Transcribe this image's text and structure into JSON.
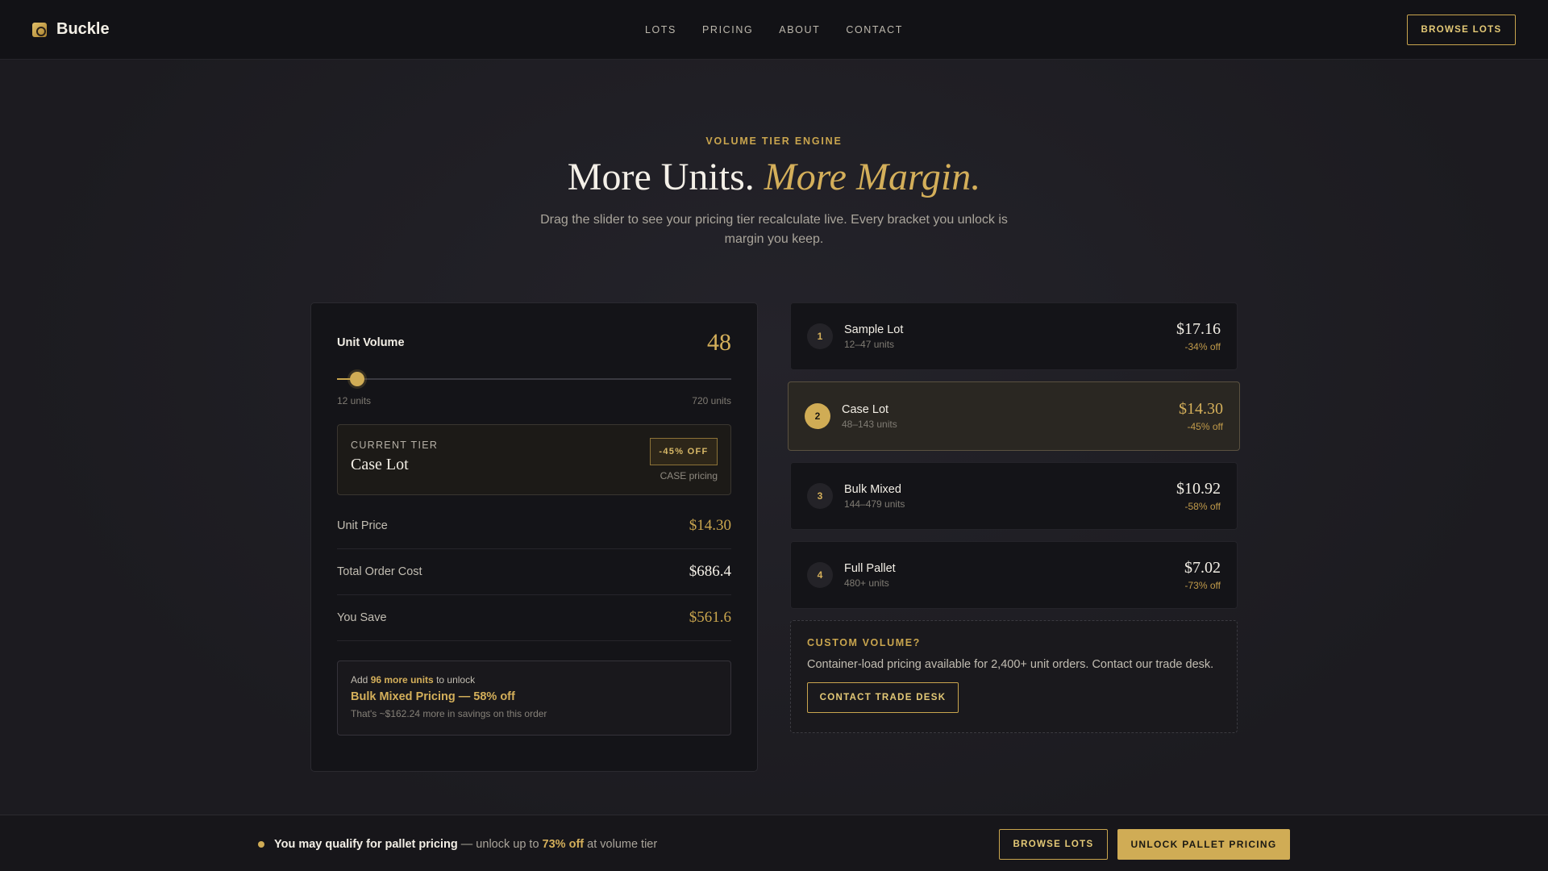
{
  "brand": {
    "name": "Buckle",
    "logo_icon": "buckle-logo-icon"
  },
  "nav": {
    "links": [
      "LOTS",
      "PRICING",
      "ABOUT",
      "CONTACT"
    ],
    "cta": "BROWSE LOTS"
  },
  "hero": {
    "eyebrow": "VOLUME TIER ENGINE",
    "title_plain": "More Units.",
    "title_accent": "More Margin.",
    "subtitle": "Drag the slider to see your pricing tier recalculate live. Every bracket you unlock is margin you keep."
  },
  "calculator": {
    "volume_label": "Unit Volume",
    "volume_value": "48",
    "slider": {
      "min": 12,
      "max": 720,
      "value": 48,
      "min_label": "12 units",
      "max_label": "720 units"
    },
    "current_tier": {
      "eyebrow": "CURRENT TIER",
      "name": "Case Lot",
      "badge": "-45% OFF",
      "note": "CASE pricing"
    },
    "stats": [
      {
        "label": "Unit Price",
        "value": "$14.30"
      },
      {
        "label": "Total Order Cost",
        "value": "$686.4"
      },
      {
        "label": "You Save",
        "value": "$561.6"
      }
    ],
    "unlock": {
      "prefix": "Add",
      "highlight": "96 more units",
      "suffix": "to unlock",
      "title": "Bulk Mixed Pricing — 58% off",
      "note": "That's ~$162.24 more in savings on this order"
    }
  },
  "tiers": [
    {
      "num": "1",
      "name": "Sample Lot",
      "range": "12–47 units",
      "price": "$17.16",
      "off": "-34% off"
    },
    {
      "num": "2",
      "name": "Case Lot",
      "range": "48–143 units",
      "price": "$14.30",
      "off": "-45% off"
    },
    {
      "num": "3",
      "name": "Bulk Mixed",
      "range": "144–479 units",
      "price": "$10.92",
      "off": "-58% off"
    },
    {
      "num": "4",
      "name": "Full Pallet",
      "range": "480+ units",
      "price": "$7.02",
      "off": "-73% off"
    }
  ],
  "custom": {
    "eyebrow": "CUSTOM VOLUME?",
    "text": "Container-load pricing available for 2,400+ unit orders. Contact our trade desk.",
    "cta": "CONTACT TRADE DESK"
  },
  "bottom_bar": {
    "bold": "You may qualify for pallet pricing",
    "middle": "— unlock up to",
    "highlight": "73% off",
    "suffix": "at volume tier",
    "browse": "BROWSE LOTS",
    "unlock": "UNLOCK PALLET PRICING"
  },
  "colors": {
    "accent": "#c9a54e",
    "background": "#1d1c22",
    "card": "#141418"
  }
}
